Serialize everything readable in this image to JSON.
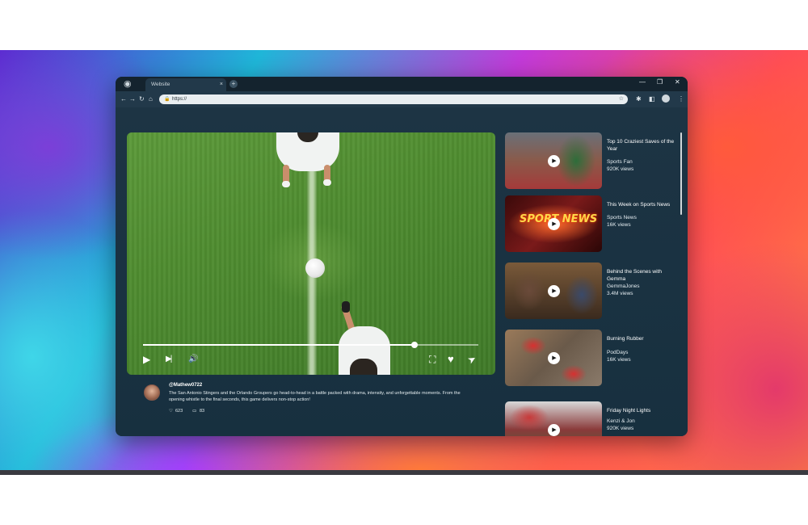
{
  "browser": {
    "tab_title": "Website",
    "tab_close": "×",
    "new_tab": "+",
    "url": "https://",
    "window_controls": {
      "minimize": "—",
      "restore": "❐",
      "close": "✕"
    }
  },
  "toolbar": {
    "back": "←",
    "forward": "→",
    "reload": "↻",
    "home": "⌂",
    "star": "☆",
    "extensions": "✱",
    "sidepanel": "◧",
    "menu": "⋮"
  },
  "player": {
    "progress_fraction": 0.81,
    "controls": {
      "play": "▶",
      "next": "▶|",
      "volume": "🔊",
      "fullscreen": "⛶",
      "like": "♥",
      "share": "➤"
    }
  },
  "comment": {
    "username": "@Mathew0722",
    "text": "The San Antonio Stingers and the Orlando Groupers go head-to-head in a battle packed with drama, intensity, and unforgettable moments. From the opening whistle to the final seconds, this game delivers non-stop action!",
    "likes": "623",
    "replies": "83",
    "like_icon": "♡",
    "reply_icon": "▭"
  },
  "recommendations": [
    {
      "title": "Top 10 Craziest Saves of the Year",
      "channel": "Sports Fan",
      "views": "920K views"
    },
    {
      "title": "This Week on Sports News",
      "channel": "Sports News",
      "views": "16K views",
      "thumb_text": "SPORT NEWS"
    },
    {
      "title": "Behind the Scenes with Gemma",
      "channel": "GemmaJones",
      "views": "3.4M views"
    },
    {
      "title": "Burning Rubber",
      "channel": "PodDays",
      "views": "16K views"
    },
    {
      "title": "Friday Night Lights",
      "channel": "Kenzi & Jon",
      "views": "920K views"
    }
  ]
}
